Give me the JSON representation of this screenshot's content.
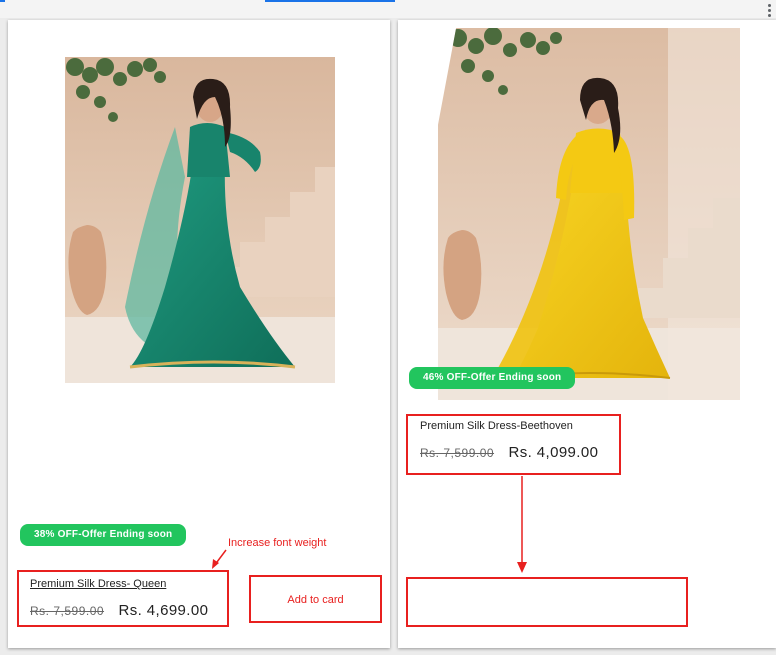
{
  "colors": {
    "annotation_red": "#e8201f",
    "badge_green": "#22c55e",
    "teal_dress": "#14876f",
    "yellow_dress": "#f2c416",
    "wall_beige": "#e8ccb4"
  },
  "products": [
    {
      "badge": "38% OFF-Offer Ending soon",
      "name": "Premium Silk Dress- Queen",
      "old_price": "Rs. 7,599.00",
      "new_price": "Rs. 4,699.00",
      "image_alt": "woman-in-teal-gown-photo"
    },
    {
      "badge": "46% OFF-Offer Ending soon",
      "name": "Premium Silk Dress-Beethoven",
      "old_price": "Rs. 7,599.00",
      "new_price": "Rs. 4,099.00",
      "image_alt": "woman-in-yellow-gown-photo"
    }
  ],
  "annotations": {
    "font_weight_note": "Increase font weight",
    "add_to_card": "Add to card"
  },
  "icons": {
    "menu": "kebab-menu-icon"
  }
}
